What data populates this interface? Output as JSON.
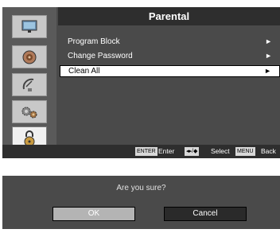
{
  "menu": {
    "title": "Parental",
    "items": [
      {
        "label": "Program Block",
        "arrow": "►",
        "selected": false
      },
      {
        "label": "Change Password",
        "arrow": "►",
        "selected": false
      },
      {
        "label": "Clean All",
        "arrow": "►",
        "selected": true
      }
    ],
    "sidebar_icons": [
      "display-icon",
      "speaker-icon",
      "satellite-dish-icon",
      "gears-icon",
      "lock-icon"
    ],
    "active_sidebar_icon": "lock-icon"
  },
  "footer": {
    "enter_key": "ENTER",
    "enter_label": "Enter",
    "nav_key": "◂▸/◆",
    "select_label": "Select",
    "menu_key": "MENU",
    "back_label": "Back"
  },
  "confirm": {
    "question": "Are you sure?",
    "ok_label": "OK",
    "cancel_label": "Cancel"
  },
  "colors": {
    "panel": "#4a4a4a",
    "title_bar": "#2e2e2e",
    "selected_item": "#ffffff"
  }
}
